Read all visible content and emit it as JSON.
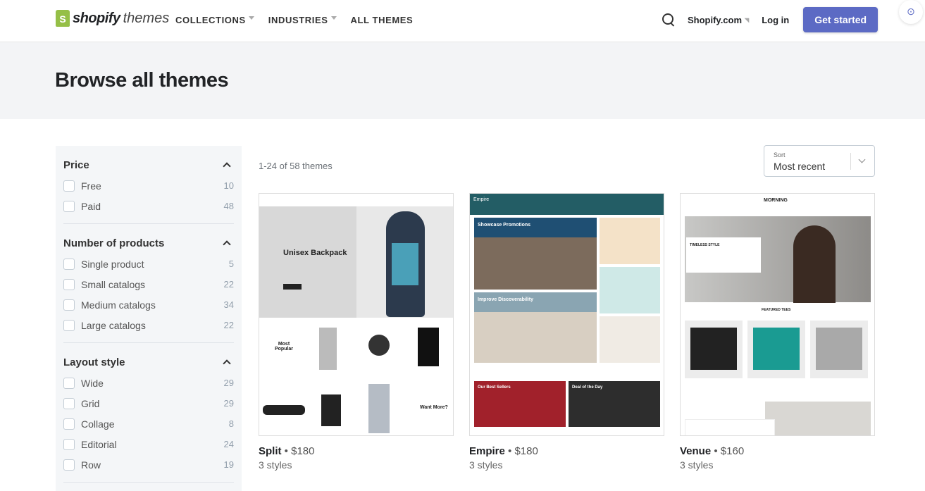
{
  "header": {
    "logo_brand": "shopify",
    "logo_sub": "themes",
    "nav": [
      {
        "label": "COLLECTIONS",
        "dropdown": true
      },
      {
        "label": "INDUSTRIES",
        "dropdown": true
      },
      {
        "label": "ALL THEMES",
        "dropdown": false
      }
    ],
    "shopify_link": "Shopify.com",
    "login": "Log in",
    "cta": "Get started",
    "accent": "#5c6ac4"
  },
  "page_title": "Browse all themes",
  "filters": [
    {
      "title": "Price",
      "options": [
        {
          "label": "Free",
          "count": "10"
        },
        {
          "label": "Paid",
          "count": "48"
        }
      ]
    },
    {
      "title": "Number of products",
      "options": [
        {
          "label": "Single product",
          "count": "5"
        },
        {
          "label": "Small catalogs",
          "count": "22"
        },
        {
          "label": "Medium catalogs",
          "count": "34"
        },
        {
          "label": "Large catalogs",
          "count": "22"
        }
      ]
    },
    {
      "title": "Layout style",
      "options": [
        {
          "label": "Wide",
          "count": "29"
        },
        {
          "label": "Grid",
          "count": "29"
        },
        {
          "label": "Collage",
          "count": "8"
        },
        {
          "label": "Editorial",
          "count": "24"
        },
        {
          "label": "Row",
          "count": "19"
        }
      ]
    }
  ],
  "results_count": "1-24 of 58 themes",
  "sort": {
    "label": "Sort",
    "value": "Most recent"
  },
  "themes": [
    {
      "name": "Split",
      "price": "$180",
      "styles": "3 styles",
      "thumb_text": [
        "Unisex Backpack",
        "Most Popular",
        "Want More?"
      ]
    },
    {
      "name": "Empire",
      "price": "$180",
      "styles": "3 styles",
      "thumb_text": [
        "Empire",
        "Showcase Promotions",
        "Improve Discoverability",
        "Our Best Sellers",
        "Deal of the Day"
      ]
    },
    {
      "name": "Venue",
      "price": "$160",
      "styles": "3 styles",
      "thumb_text": [
        "MORNING",
        "TIMELESS STYLE",
        "FEATURED TEES"
      ]
    }
  ]
}
